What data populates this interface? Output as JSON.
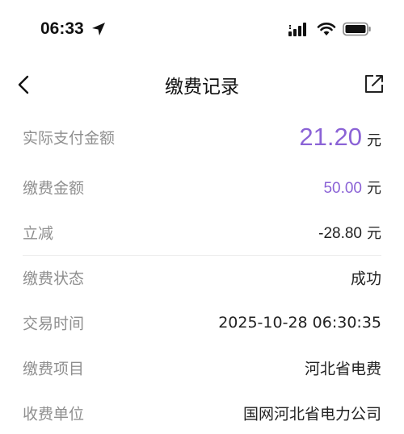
{
  "status_bar": {
    "time": "06:33"
  },
  "nav": {
    "title": "缴费记录"
  },
  "details": {
    "actual_paid": {
      "label": "实际支付金额",
      "value": "21.20",
      "unit": "元"
    },
    "payment_amount": {
      "label": "缴费金额",
      "value": "50.00",
      "unit": "元"
    },
    "discount": {
      "label": "立减",
      "value": "-28.80",
      "unit": "元"
    },
    "status": {
      "label": "缴费状态",
      "value": "成功"
    },
    "time": {
      "label": "交易时间",
      "value": "2025-10-28 06:30:35"
    },
    "item": {
      "label": "缴费项目",
      "value": "河北省电费"
    },
    "payee": {
      "label": "收费单位",
      "value": "国网河北省电力公司"
    }
  },
  "colors": {
    "accent": "#8b63d6",
    "label": "#8f8f8f",
    "text": "#222222"
  }
}
